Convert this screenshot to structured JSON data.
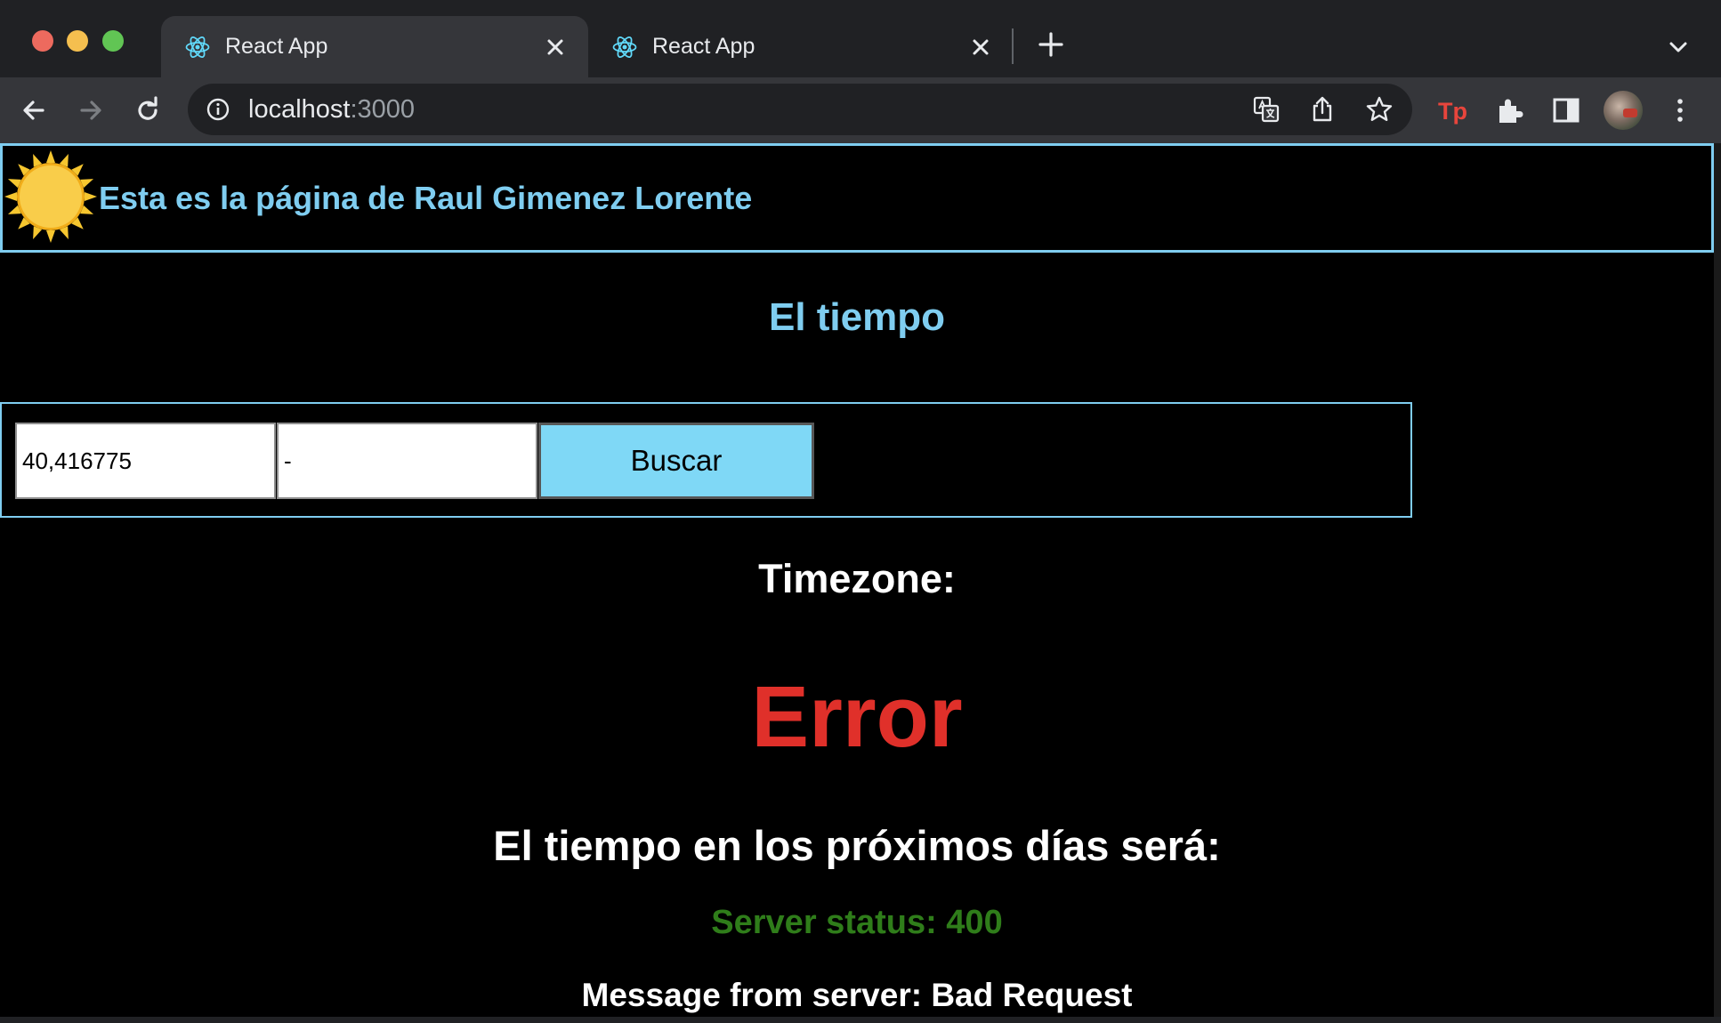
{
  "browser": {
    "tabs": [
      {
        "title": "React App"
      },
      {
        "title": "React App"
      }
    ],
    "url": {
      "host": "localhost",
      "port": ":3000"
    }
  },
  "page": {
    "header_text": "Esta es la página de Raul Gimenez Lorente",
    "section_title": "El tiempo",
    "search": {
      "latitude_value": "40,416775",
      "longitude_value": "-",
      "button_label": "Buscar"
    },
    "timezone_label": "Timezone:",
    "error_text": "Error",
    "forecast_heading": "El tiempo en los próximos días será:",
    "server_status": "Server status: 400",
    "server_message": "Message from server: Bad Request"
  },
  "colors": {
    "accent_blue": "#7fcdf0",
    "error_red": "#e0302a",
    "status_green": "#2f7d1a",
    "button_bg": "#7fd8f6"
  },
  "icons": [
    "react-favicon",
    "close-icon",
    "new-tab-icon",
    "tab-list-icon",
    "back-icon",
    "forward-icon",
    "reload-icon",
    "info-icon",
    "translate-icon",
    "share-icon",
    "bookmark-star-icon",
    "tp-extension-icon",
    "extensions-puzzle-icon",
    "side-panel-icon",
    "profile-avatar",
    "menu-kebab-icon",
    "sun-icon"
  ]
}
